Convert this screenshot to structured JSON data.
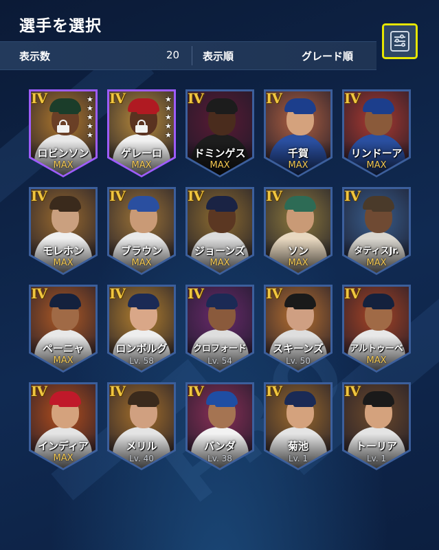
{
  "header": {
    "title": "選手を選択",
    "count_label": "表示数",
    "count_value": "20",
    "sort_label": "表示順",
    "sort_value": "グレード順",
    "filter_icon": "filter-sliders-icon"
  },
  "background": {
    "watermark": "PRO"
  },
  "cards": [
    {
      "grade": "IV",
      "name": "ロビンソン",
      "level": "MAX",
      "stars": "★★★★★",
      "locked": true,
      "frame": "#9e5cff",
      "bg": "#b27a2d",
      "cap": "#1b3d2a",
      "skin": "#6a3f26",
      "jersey": "#e8e8e8"
    },
    {
      "grade": "IV",
      "name": "ゲレーロ",
      "level": "MAX",
      "stars": "★★★★★",
      "locked": true,
      "frame": "#9e5cff",
      "bg": "#b88a3a",
      "cap": "#b01a22",
      "skin": "#5a3220",
      "jersey": "#f0f0f0"
    },
    {
      "grade": "IV",
      "name": "ドミンゲス",
      "level": "MAX",
      "stars": "",
      "locked": false,
      "frame": "#3c5f9c",
      "bg": "#5a1a33",
      "cap": "#1c1c1c",
      "skin": "#4a2c1d",
      "jersey": "#1d1d1d"
    },
    {
      "grade": "IV",
      "name": "千賀",
      "level": "MAX",
      "stars": "",
      "locked": false,
      "frame": "#3c5f9c",
      "bg": "#b06040",
      "cap": "#1c3e8c",
      "skin": "#d4a27d",
      "jersey": "#2a4fa0"
    },
    {
      "grade": "IV",
      "name": "リンドーア",
      "level": "MAX",
      "stars": "",
      "locked": false,
      "frame": "#3c5f9c",
      "bg": "#ad3a2f",
      "cap": "#1c3e8c",
      "skin": "#8a5a3a",
      "jersey": "#2a4fa0"
    },
    {
      "grade": "IV",
      "name": "モレホン",
      "level": "MAX",
      "stars": "",
      "locked": false,
      "frame": "#3c5f9c",
      "bg": "#9b6b2e",
      "cap": "#3a2a1c",
      "skin": "#caa07f",
      "jersey": "#efefef"
    },
    {
      "grade": "IV",
      "name": "ブラウン",
      "level": "MAX",
      "stars": "",
      "locked": false,
      "frame": "#3c5f9c",
      "bg": "#9e7436",
      "cap": "#2a4fa0",
      "skin": "#c99a76",
      "jersey": "#e9e9e9"
    },
    {
      "grade": "IV",
      "name": "ジョーンズ",
      "level": "MAX",
      "stars": "",
      "locked": false,
      "frame": "#3c5f9c",
      "bg": "#8f6d2f",
      "cap": "#1a2344",
      "skin": "#5b3722",
      "jersey": "#dcdcdc"
    },
    {
      "grade": "IV",
      "name": "ソン",
      "level": "MAX",
      "stars": "",
      "locked": false,
      "frame": "#3c5f9c",
      "bg": "#8f7a3c",
      "cap": "#2d6b55",
      "skin": "#c99a76",
      "jersey": "#e8d8c0"
    },
    {
      "grade": "IV",
      "name": "タティスJr.",
      "level": "MAX",
      "stars": "",
      "locked": false,
      "frame": "#3c5f9c",
      "bg": "#3a5e8c",
      "cap": "#4a3a2a",
      "skin": "#6f4a33",
      "jersey": "#d9d6cf"
    },
    {
      "grade": "IV",
      "name": "ペーニャ",
      "level": "MAX",
      "stars": "",
      "locked": false,
      "frame": "#3c5f9c",
      "bg": "#b05a24",
      "cap": "#14213d",
      "skin": "#a06a46",
      "jersey": "#e8e8e8"
    },
    {
      "grade": "IV",
      "name": "ロンボルグ",
      "level": "Lv. 58",
      "stars": "",
      "locked": false,
      "frame": "#3c5f9c",
      "bg": "#b4802e",
      "cap": "#1b2a55",
      "skin": "#d9a788",
      "jersey": "#eeeeee"
    },
    {
      "grade": "IV",
      "name": "クロフォード",
      "level": "Lv. 54",
      "stars": "",
      "locked": false,
      "frame": "#3c5f9c",
      "bg": "#6a2a6a",
      "cap": "#1b2a55",
      "skin": "#8a5a3c",
      "jersey": "#dedede"
    },
    {
      "grade": "IV",
      "name": "スキーンズ",
      "level": "Lv. 50",
      "stars": "",
      "locked": false,
      "frame": "#3c5f9c",
      "bg": "#b87030",
      "cap": "#1a1a1a",
      "skin": "#cf9f82",
      "jersey": "#dedede"
    },
    {
      "grade": "IV",
      "name": "アルトゥーベ",
      "level": "MAX",
      "stars": "",
      "locked": false,
      "frame": "#3c5f9c",
      "bg": "#a84424",
      "cap": "#14213d",
      "skin": "#a06a46",
      "jersey": "#e8e8e8"
    },
    {
      "grade": "IV",
      "name": "インディア",
      "level": "MAX",
      "stars": "",
      "locked": false,
      "frame": "#3c5f9c",
      "bg": "#b44e1c",
      "cap": "#c0192a",
      "skin": "#d4a27d",
      "jersey": "#e4e4e4"
    },
    {
      "grade": "IV",
      "name": "メリル",
      "level": "Lv. 40",
      "stars": "",
      "locked": false,
      "frame": "#3c5f9c",
      "bg": "#a6702a",
      "cap": "#3a2a1c",
      "skin": "#d0a080",
      "jersey": "#e4e4e4"
    },
    {
      "grade": "IV",
      "name": "バンダ",
      "level": "Lv. 38",
      "stars": "",
      "locked": false,
      "frame": "#3c5f9c",
      "bg": "#8b2f56",
      "cap": "#1f4ea3",
      "skin": "#a57452",
      "jersey": "#f2f2f2"
    },
    {
      "grade": "IV",
      "name": "菊池",
      "level": "Lv. 1",
      "stars": "",
      "locked": false,
      "frame": "#3c5f9c",
      "bg": "#9c6a2c",
      "cap": "#1a2a55",
      "skin": "#d4a27d",
      "jersey": "#e4e4e4"
    },
    {
      "grade": "IV",
      "name": "トーリア",
      "level": "Lv. 1",
      "stars": "",
      "locked": false,
      "frame": "#3c5f9c",
      "bg": "#6e4a2a",
      "cap": "#1a1a1a",
      "skin": "#d4a27d",
      "jersey": "#e4e4e4"
    }
  ]
}
